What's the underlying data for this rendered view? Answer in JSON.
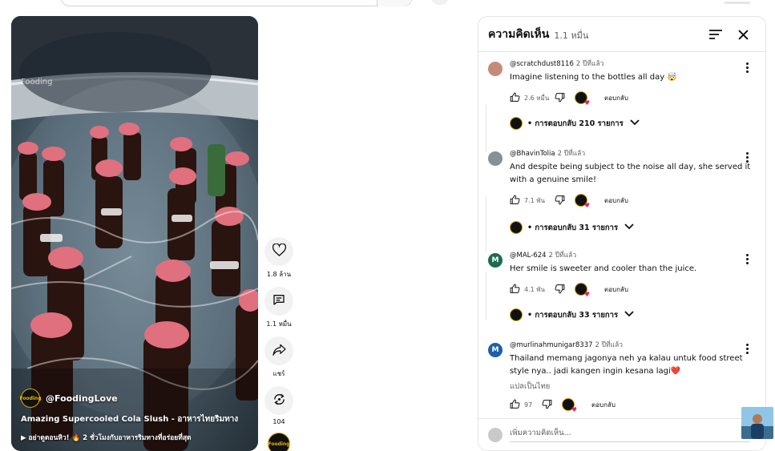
{
  "video": {
    "watermark": "Fooding",
    "channel_avatar_text": "Fooding",
    "channel_name": "@FoodingLove",
    "title": "Amazing Supercooled Cola Slush - อาหารไทยริมทาง",
    "playlist_text": "▶ อย่าดูตอนหิว! 🔥 2 ชั่วโมงกับอาหารริมทางที่อร่อยที่สุด"
  },
  "actions": {
    "like_count": "1.8 ล้าน",
    "comment_count": "1.1 หมื่น",
    "share_label": "แชร์",
    "remix_count": "104",
    "channel_avatar_text": "Fooding"
  },
  "comments_panel": {
    "title": "ความคิดเห็น",
    "count": "1.1 หมื่น",
    "add_comment_placeholder": "เพิ่มความคิดเห็น...",
    "reply_label": "ตอบกลับ",
    "comments": [
      {
        "handle": "@scratchdust8116",
        "time": "2 ปีที่แล้ว",
        "text": "Imagine listening to the bottles all day 🤯",
        "likes": "2.6 หมื่น",
        "replies": "• การตอบกลับ 210 รายการ",
        "avatar_color": "#c58a7a",
        "avatar_letter": ""
      },
      {
        "handle": "@BhavinTolia",
        "time": "2 ปีที่แล้ว",
        "text": "And despite being subject to the noise all day, she served it with a genuine smile!",
        "likes": "7.1 พัน",
        "replies": "• การตอบกลับ 31 รายการ",
        "avatar_color": "#8a8f96",
        "avatar_letter": ""
      },
      {
        "handle": "@MAL-624",
        "time": "2 ปีที่แล้ว",
        "text": "Her smile is sweeter and cooler than the juice.",
        "likes": "4.1 พัน",
        "replies": "• การตอบกลับ 33 รายการ",
        "avatar_color": "#1e6b52",
        "avatar_letter": "M"
      },
      {
        "handle": "@murlinahmunigar8337",
        "time": "2 ปีที่แล้ว",
        "text": "Thailand memang jagonya neh ya kalau untuk food street style nya.. jadi kangen ingin kesana lagi❤️",
        "translate": "แปลเป็นไทย",
        "likes": "97",
        "avatar_color": "#1f5fa8",
        "avatar_letter": "M"
      }
    ]
  },
  "icons": {
    "like": "thumb-up-icon",
    "dislike": "thumb-down-icon",
    "sort": "sort-icon",
    "close": "close-icon",
    "more": "more-vert-icon",
    "heart": "heart-icon",
    "comment": "comment-icon",
    "share": "share-icon",
    "remix": "remix-icon",
    "chevron": "chevron-down-icon"
  }
}
